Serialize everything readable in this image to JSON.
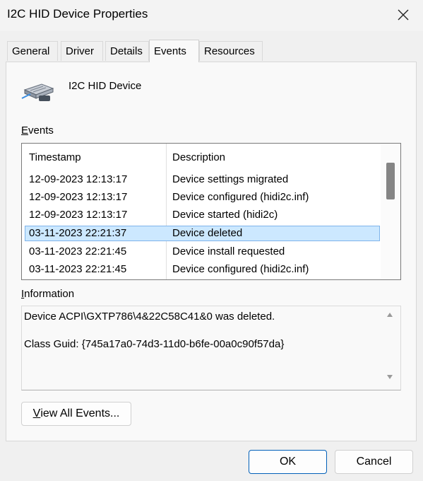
{
  "window": {
    "title": "I2C HID Device Properties"
  },
  "tabs": [
    {
      "label": "General"
    },
    {
      "label": "Driver"
    },
    {
      "label": "Details"
    },
    {
      "label": "Events",
      "active": true
    },
    {
      "label": "Resources"
    }
  ],
  "device": {
    "name": "I2C HID Device",
    "icon": "hid-device-icon"
  },
  "events": {
    "label_first": "E",
    "label_rest": "vents",
    "columns": [
      "Timestamp",
      "Description"
    ],
    "rows": [
      {
        "timestamp": "12-09-2023 12:13:17",
        "description": "Device settings migrated"
      },
      {
        "timestamp": "12-09-2023 12:13:17",
        "description": "Device configured (hidi2c.inf)"
      },
      {
        "timestamp": "12-09-2023 12:13:17",
        "description": "Device started (hidi2c)"
      },
      {
        "timestamp": "03-11-2023 22:21:37",
        "description": "Device deleted",
        "selected": true
      },
      {
        "timestamp": "03-11-2023 22:21:45",
        "description": "Device install requested"
      },
      {
        "timestamp": "03-11-2023 22:21:45",
        "description": "Device configured (hidi2c.inf)"
      }
    ]
  },
  "information": {
    "label_first": "I",
    "label_rest": "nformation",
    "line1": "Device ACPI\\GXTP786\\4&22C58C41&0 was deleted.",
    "line2": "Class Guid: {745a17a0-74d3-11d0-b6fe-00a0c90f57da}"
  },
  "buttons": {
    "view_all_first": "V",
    "view_all_rest": "iew All Events...",
    "ok": "OK",
    "cancel": "Cancel"
  },
  "colors": {
    "selected_row": "#cce8ff",
    "ok_border": "#005fb8"
  }
}
